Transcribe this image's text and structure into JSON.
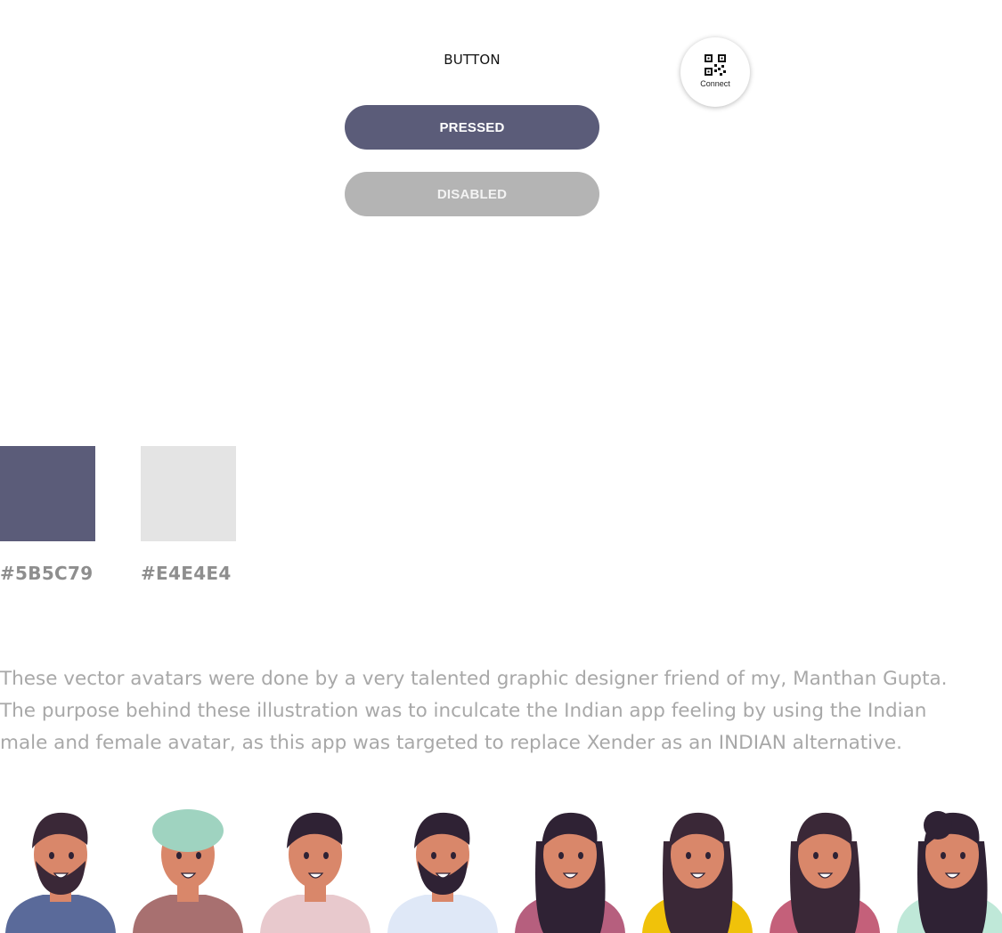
{
  "button_states": {
    "label": "BUTTON",
    "pressed_label": "PRESSED",
    "disabled_label": "DISABLED"
  },
  "fab": {
    "icon": "qr-code-icon",
    "label": "Connect"
  },
  "palette": [
    {
      "hex": "#5B5C79",
      "color": "#5b5c79"
    },
    {
      "hex": "#E4E4E4",
      "color": "#e4e4e4"
    }
  ],
  "description": "These vector avatars were done by a very talented graphic designer friend of my, Manthan Gupta. The purpose behind these illustration was to inculcate the Indian app feeling by using the Indian male and female avatar, as this app was targeted to replace Xender as an INDIAN alternative.",
  "avatars": [
    {
      "name": "avatar-man-beard",
      "skin": "#d9876a",
      "hair": "#3a2837",
      "shirt": "#5a6a9a",
      "headwear": "none"
    },
    {
      "name": "avatar-man-turban",
      "skin": "#d9876a",
      "hair": "#3a2837",
      "shirt": "#a87070",
      "headwear": "#9fd3c0"
    },
    {
      "name": "avatar-man-quiff",
      "skin": "#d9876a",
      "hair": "#2f2234",
      "shirt": "#e8c9cd",
      "headwear": "none"
    },
    {
      "name": "avatar-man-full-beard",
      "skin": "#d9876a",
      "hair": "#2f2234",
      "shirt": "#dfe8f7",
      "headwear": "none"
    },
    {
      "name": "avatar-woman-ponytail",
      "skin": "#d9876a",
      "hair": "#2f2234",
      "shirt": "#b65f7e",
      "headwear": "none"
    },
    {
      "name": "avatar-woman-long-hair",
      "skin": "#d9876a",
      "hair": "#3a2837",
      "shirt": "#f0c20a",
      "headwear": "none"
    },
    {
      "name": "avatar-woman-straight-hair",
      "skin": "#d9876a",
      "hair": "#3a2837",
      "shirt": "#c4607a",
      "headwear": "none"
    },
    {
      "name": "avatar-woman-bun",
      "skin": "#d9876a",
      "hair": "#2f2234",
      "shirt": "#bfe8d8",
      "headwear": "none"
    }
  ]
}
